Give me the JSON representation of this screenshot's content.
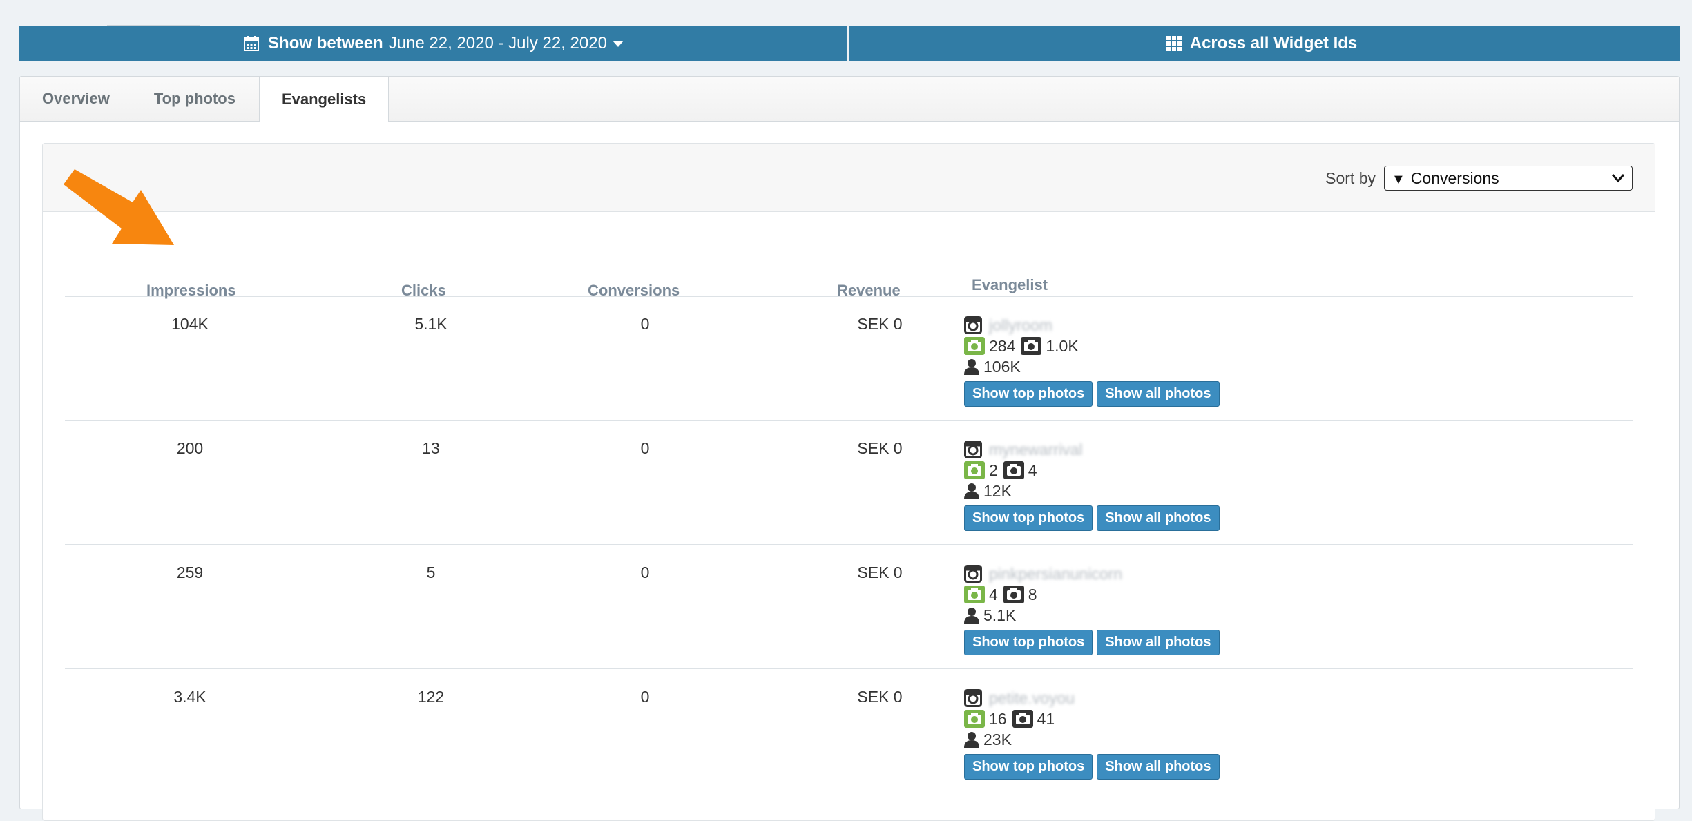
{
  "filters": {
    "date_prefix": "Show between",
    "date_range": "June 22, 2020 - July 22, 2020",
    "widget_scope": "Across all Widget Ids"
  },
  "tabs": [
    {
      "label": "Overview"
    },
    {
      "label": "Top photos"
    },
    {
      "label": "Evangelists"
    }
  ],
  "active_tab": "Evangelists",
  "sort": {
    "label": "Sort by",
    "selected": "Conversions"
  },
  "columns": {
    "impressions": "Impressions",
    "clicks": "Clicks",
    "conversions": "Conversions",
    "revenue": "Revenue",
    "evangelist": "Evangelist"
  },
  "rows": [
    {
      "impressions": "104K",
      "clicks": "5.1K",
      "conversions": "0",
      "revenue": "SEK 0",
      "username": "jollyroom",
      "photos_green": "284",
      "photos_dark": "1.0K",
      "followers": "106K"
    },
    {
      "impressions": "200",
      "clicks": "13",
      "conversions": "0",
      "revenue": "SEK 0",
      "username": "mynewarrival",
      "photos_green": "2",
      "photos_dark": "4",
      "followers": "12K"
    },
    {
      "impressions": "259",
      "clicks": "5",
      "conversions": "0",
      "revenue": "SEK 0",
      "username": "pinkpersianunicorn",
      "photos_green": "4",
      "photos_dark": "8",
      "followers": "5.1K"
    },
    {
      "impressions": "3.4K",
      "clicks": "122",
      "conversions": "0",
      "revenue": "SEK 0",
      "username": "petite.voyou",
      "photos_green": "16",
      "photos_dark": "41",
      "followers": "23K"
    }
  ],
  "buttons": {
    "top": "Show top photos",
    "all": "Show all photos"
  },
  "colors": {
    "bar": "#317ca5",
    "button": "#3c8dc0",
    "arrow": "#f7860f",
    "camera_green": "#7ab648"
  }
}
